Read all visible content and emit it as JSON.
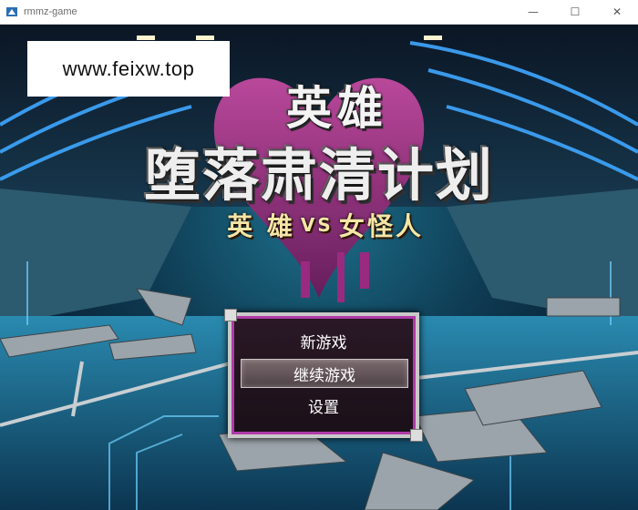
{
  "window": {
    "title": "rmmz-game",
    "controls": {
      "minimize": "—",
      "maximize": "☐",
      "close": "✕"
    }
  },
  "watermark": "www.feixw.top",
  "logo": {
    "line1": "英雄",
    "line2": "堕落肃清计划",
    "subtitle_left": "英 雄",
    "subtitle_vs": "VS",
    "subtitle_right": "女怪人"
  },
  "menu": {
    "items": [
      "新游戏",
      "继续游戏",
      "设置"
    ],
    "selected_index": 1
  },
  "colors": {
    "menu_border": "#c9c9c9",
    "menu_inner_border": "#b03aa8",
    "heart": "#a0307f",
    "neon": "#3fa7ff"
  }
}
